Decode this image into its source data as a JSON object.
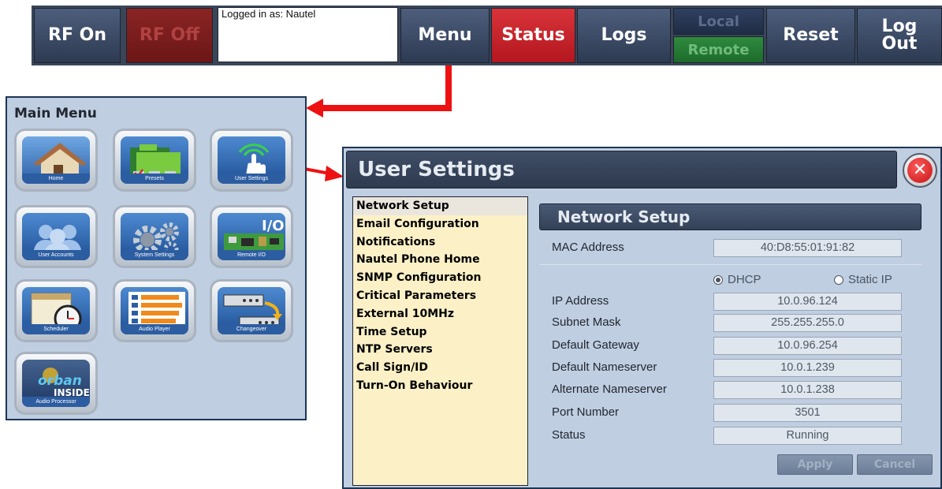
{
  "toolbar": {
    "rf_on": "RF On",
    "rf_off": "RF Off",
    "logged_in": "Logged in as: Nautel",
    "menu": "Menu",
    "status": "Status",
    "logs": "Logs",
    "local": "Local",
    "remote": "Remote",
    "reset": "Reset",
    "logout_line1": "Log",
    "logout_line2": "Out"
  },
  "main_menu": {
    "title": "Main Menu",
    "items": [
      {
        "label": "Home",
        "icon": "home-icon"
      },
      {
        "label": "Presets",
        "icon": "folders-icon"
      },
      {
        "label": "User Settings",
        "icon": "touch-hand-icon"
      },
      {
        "label": "User Accounts",
        "icon": "users-icon"
      },
      {
        "label": "System Settings",
        "icon": "gears-icon"
      },
      {
        "label": "Remote I/O",
        "icon": "circuit-board-icon"
      },
      {
        "label": "Scheduler",
        "icon": "calendar-clock-icon"
      },
      {
        "label": "Audio Player",
        "icon": "playlist-icon"
      },
      {
        "label": "Changeover",
        "icon": "changeover-icon"
      },
      {
        "label": "Audio Processor",
        "icon": "orban-logo-icon",
        "logo_text": "orban",
        "logo_subtext": "INSIDE"
      }
    ]
  },
  "user_settings": {
    "title": "User Settings",
    "list": [
      "Network Setup",
      "Email Configuration",
      "Notifications",
      "Nautel Phone Home",
      "SNMP Configuration",
      "Critical Parameters",
      "External 10MHz",
      "Time Setup",
      "NTP Servers",
      "Call Sign/ID",
      "Turn-On Behaviour"
    ],
    "selected_index": 0,
    "network": {
      "title": "Network Setup",
      "mac_label": "MAC Address",
      "mac_value": "40:D8:55:01:91:82",
      "dhcp_label": "DHCP",
      "static_label": "Static IP",
      "mode": "DHCP",
      "fields": [
        {
          "label": "IP Address",
          "value": "10.0.96.124"
        },
        {
          "label": "Subnet Mask",
          "value": "255.255.255.0"
        },
        {
          "label": "Default Gateway",
          "value": "10.0.96.254"
        },
        {
          "label": "Default Nameserver",
          "value": "10.0.1.239"
        },
        {
          "label": "Alternate Nameserver",
          "value": "10.0.1.238"
        },
        {
          "label": "Port Number",
          "value": "3501"
        },
        {
          "label": "Status",
          "value": "Running"
        }
      ],
      "apply": "Apply",
      "cancel": "Cancel"
    }
  },
  "colors": {
    "toolbar_bg": "#3a4658",
    "accent_red": "#ee1111",
    "panel_bg": "#c0cee2",
    "list_bg": "#fcf1c6"
  }
}
